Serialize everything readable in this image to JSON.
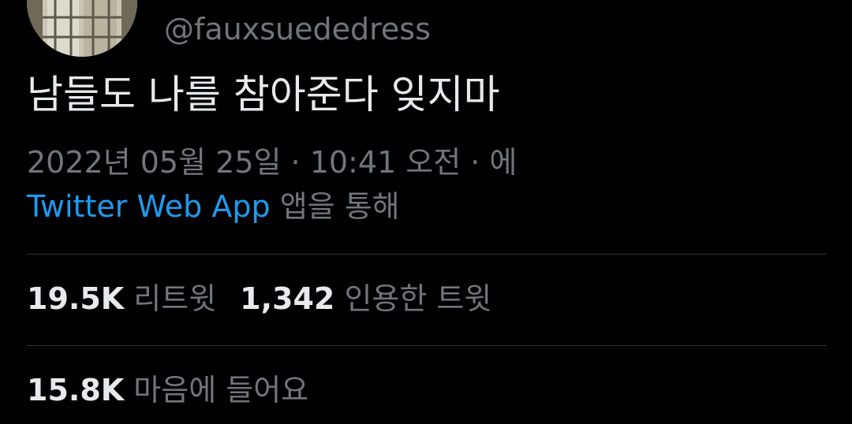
{
  "tweet": {
    "handle": "@fauxsuededress",
    "text": "남들도 나를 참아준다 잊지마",
    "timestamp": "2022년 05월 25일 · 10:41 오전 · 에",
    "source_app": "Twitter Web App",
    "source_suffix": " 앱을 통해"
  },
  "stats": {
    "retweets": {
      "value": "19.5K",
      "label": " 리트윗"
    },
    "quotes": {
      "value": "1,342",
      "label": " 인용한 트윗"
    },
    "likes": {
      "value": "15.8K",
      "label": " 마음에 들어요"
    }
  },
  "colors": {
    "background": "#000000",
    "primary_text": "#e7e9ea",
    "secondary_text": "#71767b",
    "link": "#1d9bf0",
    "divider": "#2f3336"
  }
}
